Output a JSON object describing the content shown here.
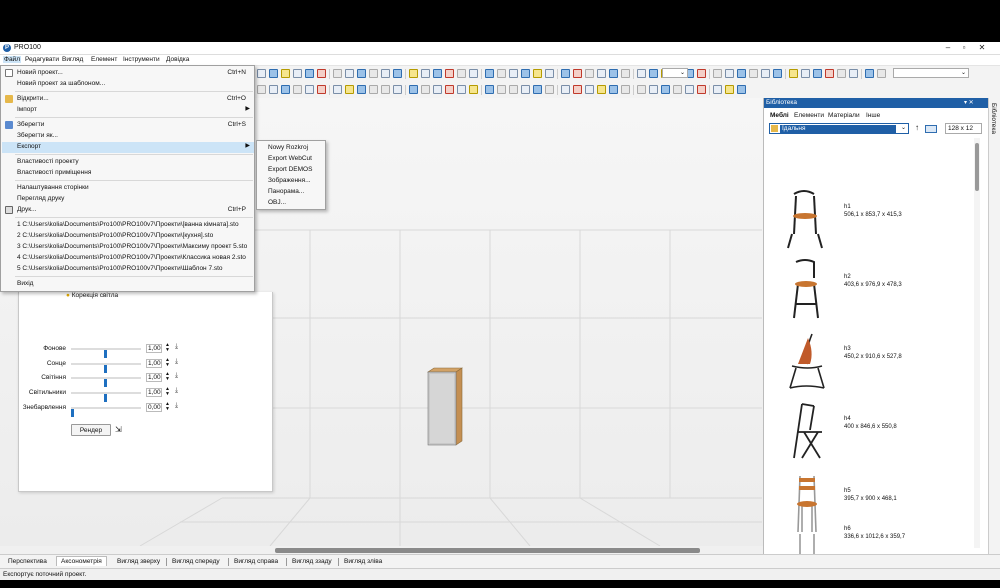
{
  "window": {
    "title": "PRO100",
    "icon_text": "P"
  },
  "menubar": [
    "Файл",
    "Редагувати",
    "Вигляд",
    "Елемент",
    "Інструменти",
    "Довідка"
  ],
  "file_menu": {
    "items": [
      {
        "label": "Новий проект...",
        "shortcut": "Ctrl+N"
      },
      {
        "label": "Новий проект за шаблоном...",
        "shortcut": ""
      },
      {
        "label": "Відкрити...",
        "shortcut": "Ctrl+O"
      },
      {
        "label": "Імпорт",
        "shortcut": ""
      },
      {
        "label": "Зберегти",
        "shortcut": "Ctrl+S"
      },
      {
        "label": "Зберегти як...",
        "shortcut": ""
      },
      {
        "label": "Експорт",
        "shortcut": ""
      },
      {
        "label": "Властивості проекту",
        "shortcut": ""
      },
      {
        "label": "Властивості приміщення",
        "shortcut": ""
      },
      {
        "label": "Налаштування сторінки",
        "shortcut": ""
      },
      {
        "label": "Перегляд друку",
        "shortcut": ""
      },
      {
        "label": "Друк...",
        "shortcut": "Ctrl+P"
      },
      {
        "label": "Вихід",
        "shortcut": ""
      }
    ],
    "recent": [
      "1 C:\\Users\\kolia\\Documents\\Pro100\\PRO100v7\\Проекти\\[ванна кімната].sto",
      "2 C:\\Users\\kolia\\Documents\\Pro100\\PRO100v7\\Проекти\\[кухня].sto",
      "3 C:\\Users\\kolia\\Documents\\Pro100\\PRO100v7\\Проекти\\Максиму проект 5.sto",
      "4 C:\\Users\\kolia\\Documents\\Pro100\\PRO100v7\\Проекти\\Классика новая 2.sto",
      "5 C:\\Users\\kolia\\Documents\\Pro100\\PRO100v7\\Проекти\\Шаблон 7.sto"
    ]
  },
  "export_submenu": [
    "Nowy Rozkroj",
    "Export WebCut",
    "Export DEMOS",
    "Зображення...",
    "Панорама...",
    "OBJ..."
  ],
  "lighting": {
    "header": "Корекція світла",
    "rows": [
      {
        "label": "Фонове",
        "value": "1,00",
        "level": 0.5
      },
      {
        "label": "Сонце",
        "value": "1,00",
        "level": 0.5
      },
      {
        "label": "Світіння",
        "value": "1,00",
        "level": 0.5
      },
      {
        "label": "Світильники",
        "value": "1,00",
        "level": 0.5
      },
      {
        "label": "Знебарвлення",
        "value": "0,00",
        "level": 0
      }
    ],
    "render_label": "Рендер"
  },
  "library": {
    "title": "Бібліотека",
    "tabs": [
      "Меблі",
      "Елементи",
      "Матеріали",
      "Інше"
    ],
    "folder": "Їдальня",
    "thumb_size": "128 x 12",
    "items": [
      {
        "name": "h1",
        "dims": "506,1 x 853,7 x 415,3"
      },
      {
        "name": "h2",
        "dims": "403,6 x 976,9 x 478,3"
      },
      {
        "name": "h3",
        "dims": "450,2 x 910,6 x 527,8"
      },
      {
        "name": "h4",
        "dims": "400 x 846,6 x 550,8"
      },
      {
        "name": "h5",
        "dims": "395,7 x 900 x 468,1"
      },
      {
        "name": "h6",
        "dims": "336,6 x 1012,6 x 359,7"
      }
    ],
    "side_label": "Бібліотека"
  },
  "view_tabs": [
    "Перспектива",
    "Аксонометрія",
    "Вигляд зверху",
    "Вигляд спереду",
    "Вигляд справа",
    "Вигляд ззаду",
    "Вигляд зліва"
  ],
  "active_view_tab": 1,
  "status": "Експортує поточний проект."
}
